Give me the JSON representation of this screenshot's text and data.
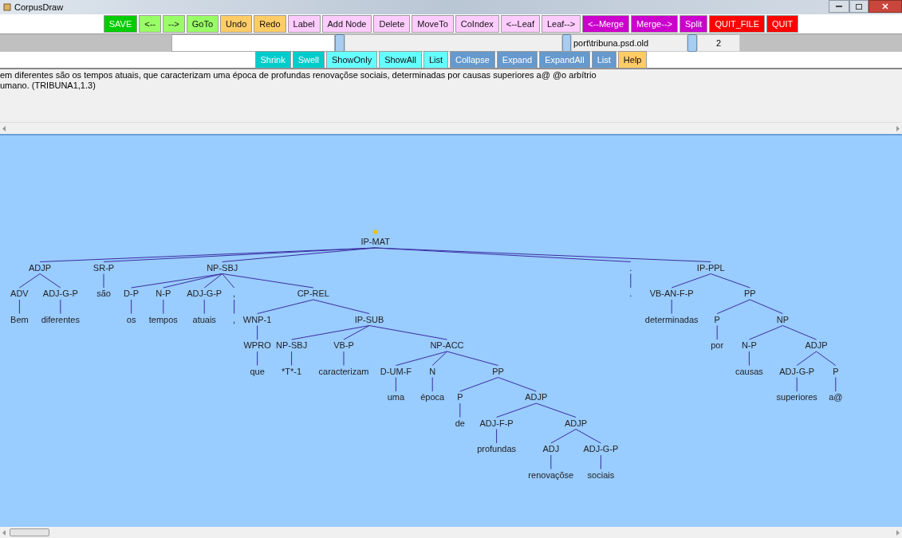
{
  "window": {
    "title": "CorpusDraw"
  },
  "toolbar_top": [
    {
      "label": "SAVE",
      "color": "#00cc00"
    },
    {
      "label": "<--",
      "color": "#99ff66"
    },
    {
      "label": "-->",
      "color": "#99ff66"
    },
    {
      "label": "GoTo",
      "color": "#99ff66"
    },
    {
      "label": "Undo",
      "color": "#ffcc66"
    },
    {
      "label": "Redo",
      "color": "#ffcc66"
    },
    {
      "label": "Label",
      "color": "#ffccff"
    },
    {
      "label": "Add Node",
      "color": "#ffccff"
    },
    {
      "label": "Delete",
      "color": "#ffccff"
    },
    {
      "label": "MoveTo",
      "color": "#ffccff"
    },
    {
      "label": "CoIndex",
      "color": "#ffccff"
    },
    {
      "label": "<--Leaf",
      "color": "#ffccff"
    },
    {
      "label": "Leaf-->",
      "color": "#ffccff"
    },
    {
      "label": "<--Merge",
      "color": "#cc00cc"
    },
    {
      "label": "Merge-->",
      "color": "#cc00cc"
    },
    {
      "label": "Split",
      "color": "#cc00cc"
    },
    {
      "label": "QUIT_FILE",
      "color": "#ff0000"
    },
    {
      "label": "QUIT",
      "color": "#ff0000"
    }
  ],
  "file_bar": {
    "file_path": "port\\tribuna.psd.old",
    "tree_number": "2"
  },
  "toolbar_bottom": [
    {
      "label": "Shrink",
      "color": "#00cccc"
    },
    {
      "label": "Swell",
      "color": "#00cccc"
    },
    {
      "label": "ShowOnly",
      "color": "#66ffff"
    },
    {
      "label": "ShowAll",
      "color": "#66ffff"
    },
    {
      "label": "List",
      "color": "#66ffff"
    },
    {
      "label": "Collapse",
      "color": "#6699cc"
    },
    {
      "label": "Expand",
      "color": "#6699cc"
    },
    {
      "label": "ExpandAll",
      "color": "#6699cc"
    },
    {
      "label": "List",
      "color": "#6699cc"
    },
    {
      "label": "Help",
      "color": "#ffcc66"
    }
  ],
  "sentence_lines": [
    "em diferentes são os tempos atuais, que caracterizam uma época de profundas renovaçõse sociais, determinadas por causas superiores a@ @o arbítrio",
    "umano.  (TRIBUNA1,1.3)"
  ],
  "tree": {
    "label": "IP-MAT",
    "selected": true,
    "children": [
      {
        "label": "ADJP",
        "selected": false,
        "children": [
          {
            "label": "ADV",
            "word": "Bem",
            "selected": false
          },
          {
            "label": "ADJ-G-P",
            "word": "diferentes",
            "selected": false
          }
        ]
      },
      {
        "label": "SR-P",
        "word": "são",
        "selected": false
      },
      {
        "label": "NP-SBJ",
        "selected": false,
        "children": [
          {
            "label": "D-P",
            "word": "os",
            "selected": false
          },
          {
            "label": "N-P",
            "word": "tempos",
            "selected": false
          },
          {
            "label": "ADJ-G-P",
            "word": "atuais",
            "selected": false
          },
          {
            "label": ",",
            "word": ",",
            "selected": false
          },
          {
            "label": "CP-REL",
            "selected": false,
            "children": [
              {
                "label": "WNP-1",
                "selected": false,
                "children": [
                  {
                    "label": "WPRO",
                    "word": "que",
                    "selected": false
                  }
                ]
              },
              {
                "label": "IP-SUB",
                "selected": false,
                "children": [
                  {
                    "label": "NP-SBJ",
                    "word": "*T*-1",
                    "selected": false
                  },
                  {
                    "label": "VB-P",
                    "word": "caracterizam",
                    "selected": false
                  },
                  {
                    "label": "NP-ACC",
                    "selected": false,
                    "children": [
                      {
                        "label": "D-UM-F",
                        "word": "uma",
                        "selected": false
                      },
                      {
                        "label": "N",
                        "word": "época",
                        "selected": false
                      },
                      {
                        "label": "PP",
                        "selected": false,
                        "children": [
                          {
                            "label": "P",
                            "word": "de",
                            "selected": false
                          },
                          {
                            "label": "ADJP",
                            "selected": false,
                            "children": [
                              {
                                "label": "ADJ-F-P",
                                "word": "profundas",
                                "selected": false
                              },
                              {
                                "label": "ADJP",
                                "selected": false,
                                "children": [
                                  {
                                    "label": "ADJ",
                                    "word": "renovaçõse",
                                    "selected": false
                                  },
                                  {
                                    "label": "ADJ-G-P",
                                    "word": "sociais",
                                    "selected": false
                                  }
                                ]
                              }
                            ]
                          }
                        ]
                      }
                    ]
                  }
                ]
              }
            ]
          }
        ]
      },
      {
        "label": ".",
        "word": ".",
        "selected": false
      },
      {
        "label": "IP-PPL",
        "selected": false,
        "children": [
          {
            "label": "VB-AN-F-P",
            "word": "determinadas",
            "selected": false
          },
          {
            "label": "PP",
            "selected": false,
            "children": [
              {
                "label": "P",
                "word": "por",
                "selected": false
              },
              {
                "label": "NP",
                "selected": false,
                "children": [
                  {
                    "label": "N-P",
                    "word": "causas",
                    "selected": false
                  },
                  {
                    "label": "ADJP",
                    "selected": false,
                    "children": [
                      {
                        "label": "ADJ-G-P",
                        "word": "superiores",
                        "selected": false
                      },
                      {
                        "label": "P",
                        "word": "a@",
                        "selected": false
                      }
                    ]
                  }
                ]
              }
            ]
          }
        ]
      }
    ]
  }
}
